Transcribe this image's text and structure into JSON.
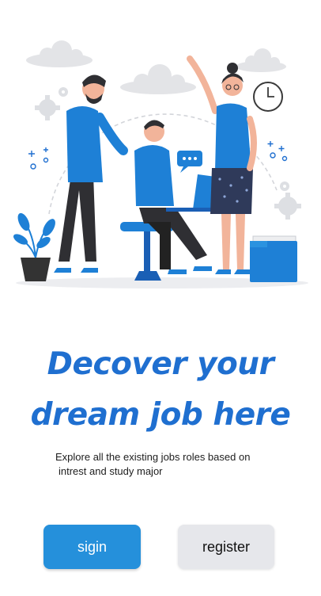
{
  "headline": {
    "line1": "Decover your",
    "line2": "dream job here"
  },
  "subtitle": {
    "line1": "Explore all the existing jobs roles based on",
    "line2": "intrest and study major"
  },
  "buttons": {
    "signin_label": "sigin",
    "register_label": "register"
  },
  "colors": {
    "accent": "#2590DB",
    "headline": "#1F6FD0",
    "secondary_button": "#E6E7EB"
  }
}
